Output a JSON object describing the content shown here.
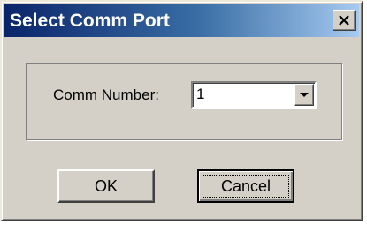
{
  "dialog": {
    "title": "Select Comm Port",
    "close_label": "X"
  },
  "comm": {
    "label": "Comm Number:",
    "value": "1"
  },
  "buttons": {
    "ok_label": "OK",
    "cancel_label": "Cancel"
  },
  "colors": {
    "title_gradient_start": "#0a246a",
    "title_gradient_end": "#a6caf0",
    "face": "#d4d0c8"
  },
  "icons": {
    "close": "close-icon",
    "dropdown": "chevron-down-icon"
  }
}
